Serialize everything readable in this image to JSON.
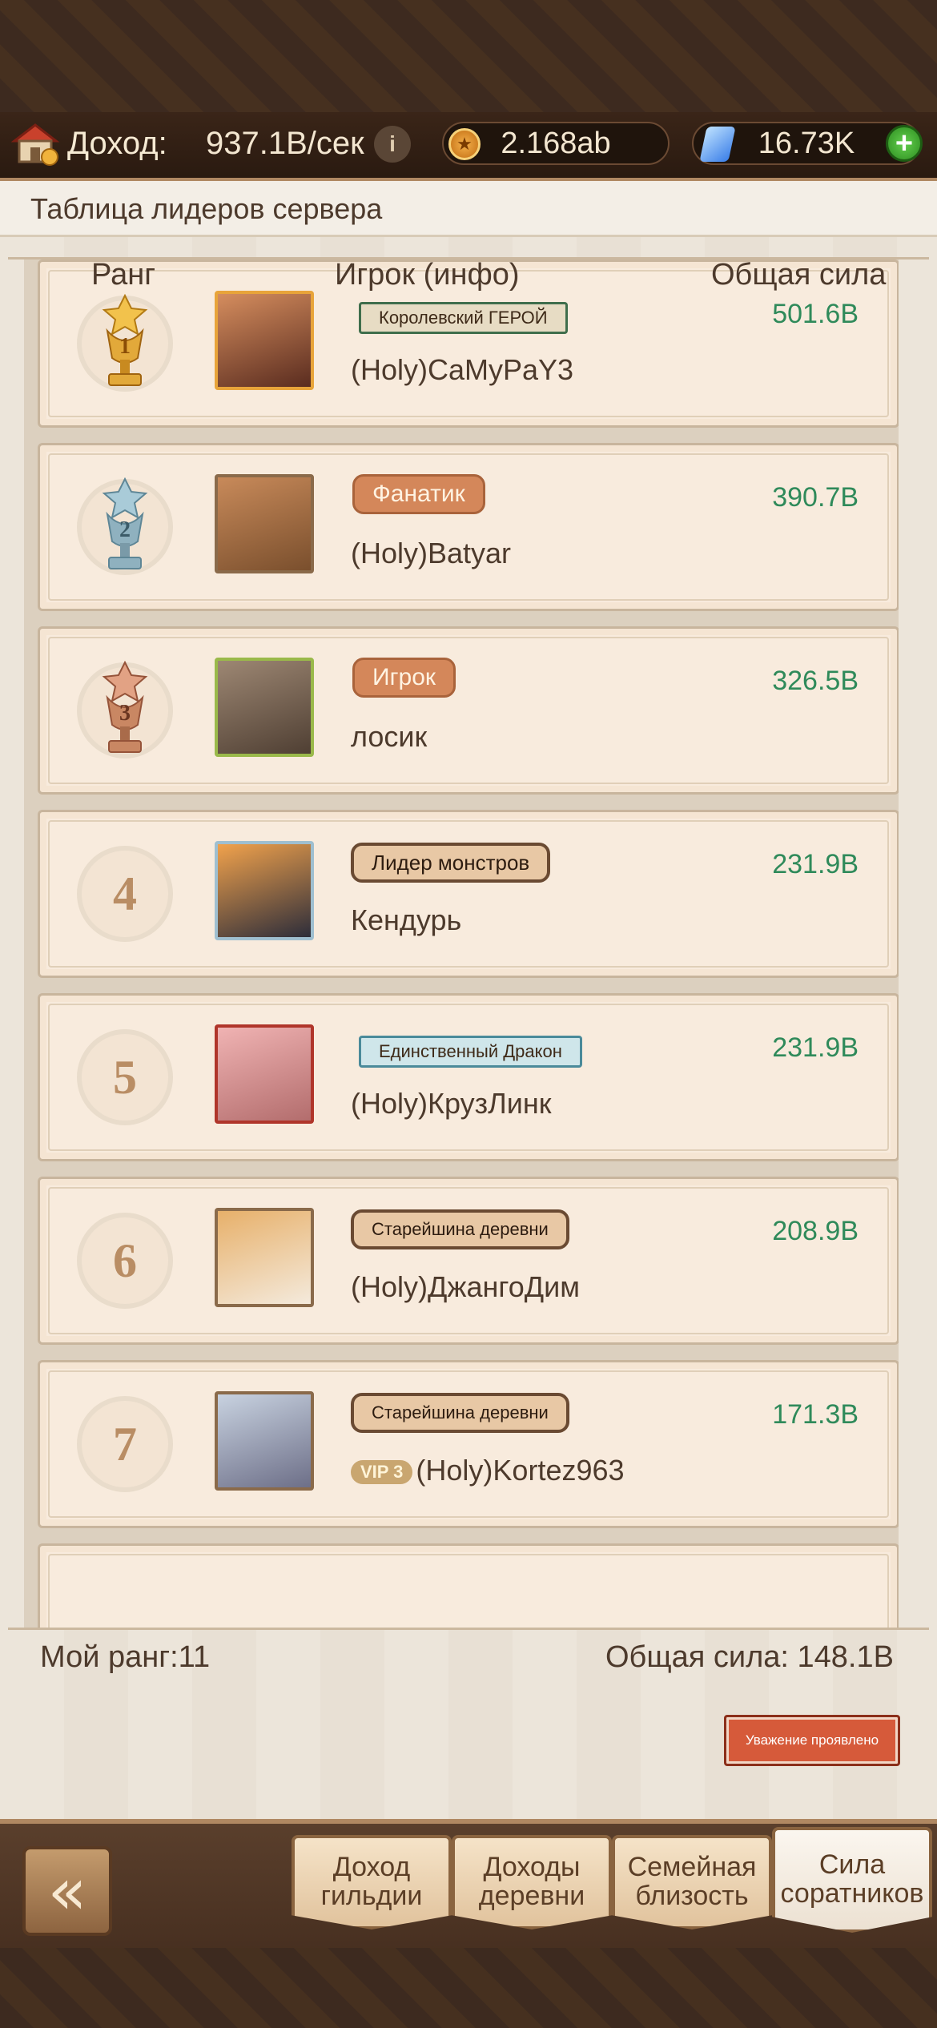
{
  "currency": {
    "income_label": "Доход:",
    "income_value": "937.1B/сек",
    "coins": "2.168ab",
    "gems": "16.73K"
  },
  "panel": {
    "title": "Таблица лидеров сервера",
    "columns": {
      "rank": "Ранг",
      "player": "Игрок (инфо)",
      "power": "Общая сила"
    }
  },
  "rows": [
    {
      "rank": "1",
      "title": "Королевский ГЕРОЙ",
      "name": "(Holy)CaMyPaY3",
      "power": "501.6B",
      "vip": ""
    },
    {
      "rank": "2",
      "title": "Фанатик",
      "name": "(Holy)Batyar",
      "power": "390.7B",
      "vip": ""
    },
    {
      "rank": "3",
      "title": "Игрок",
      "name": "лосик",
      "power": "326.5B",
      "vip": ""
    },
    {
      "rank": "4",
      "title": "Лидер монстров",
      "name": "Кендурь",
      "power": "231.9B",
      "vip": ""
    },
    {
      "rank": "5",
      "title": "Единственный Дракон",
      "name": "(Holy)КрузЛинк",
      "power": "231.9B",
      "vip": ""
    },
    {
      "rank": "6",
      "title": "Старейшина деревни",
      "name": "(Holy)ДжангоДим",
      "power": "208.9B",
      "vip": ""
    },
    {
      "rank": "7",
      "title": "Старейшина деревни",
      "name": "(Holy)Kortez963",
      "power": "171.3B",
      "vip": "VIP 3"
    }
  ],
  "footer": {
    "my_rank": "Мой ранг:11",
    "total_power": "Общая сила:  148.1B",
    "respect_button": "Уважение проявлено"
  },
  "tabs": [
    {
      "label": "Доход гильдии",
      "active": false
    },
    {
      "label": "Доходы деревни",
      "active": false
    },
    {
      "label": "Семейная близость",
      "active": false
    },
    {
      "label": "Сила соратников",
      "active": true
    }
  ],
  "colors": {
    "power_green": "#2f8a5a",
    "respect_red": "#d65a3a",
    "gold": "#e2a93a",
    "silver": "#8fb1bf",
    "bronze": "#c98763"
  }
}
